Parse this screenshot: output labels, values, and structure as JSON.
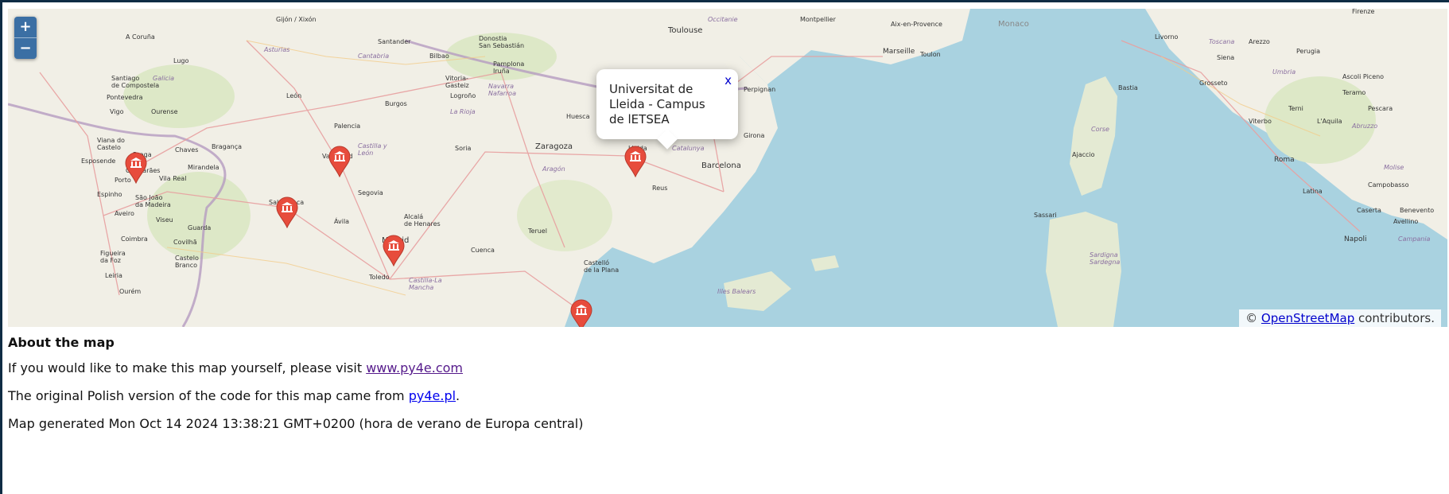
{
  "map": {
    "zoom_in_label": "+",
    "zoom_out_label": "−",
    "popup": {
      "title": "Universitat de Lleida - Campus de lETSEA",
      "close_label": "x"
    },
    "attribution": {
      "prefix": "© ",
      "link_text": "OpenStreetMap",
      "suffix": " contributors."
    },
    "marker_icon": "museum-icon",
    "marker_color": "#e74c3c",
    "places": {
      "gijon": "Gijón / Xixón",
      "santander": "Santander",
      "bilbao": "Bilbao",
      "donostia": "Donostia\nSan Sebastián",
      "toulouse": "Toulouse",
      "montpellier": "Montpellier",
      "aix": "Aix-en-Provence",
      "marseille": "Marseille",
      "toulon": "Toulon",
      "monaco": "Monaco",
      "firenze": "Firenze",
      "coruna": "A Coruña",
      "lugo": "Lugo",
      "asturias": "Asturias",
      "cantabria": "Cantabria",
      "pamplona": "Pamplona\nIruña",
      "vitoria": "Vitoria-\nGasteiz",
      "santiago": "Santiago\nde Compostela",
      "galicia": "Galicia",
      "leon": "León",
      "burgos": "Burgos",
      "logrono": "Logroño",
      "navarra": "Navarra\nNafarroa",
      "larioja": "La Rioja",
      "huesca": "Huesca",
      "perpignan": "Perpignan",
      "pontevedra": "Pontevedra",
      "vigo": "Vigo",
      "ourense": "Ourense",
      "palencia": "Palencia",
      "castilla": "Castilla y\nLeón",
      "girona": "Girona",
      "zaragoza": "Zaragoza",
      "lleida": "Lleida",
      "catalunya": "Catalunya",
      "barcelona": "Barcelona",
      "viana": "Viana do\nCastelo",
      "braga": "Braga",
      "chaves": "Chaves",
      "braganca": "Bragança",
      "valladolid": "Valladolid",
      "soria": "Soria",
      "esposende": "Esposende",
      "guimaraes": "Guimarães",
      "mirandela": "Mirandela",
      "vilareal": "Vila Real",
      "porto": "Porto",
      "aragon": "Aragón",
      "salamanca": "Salamanca",
      "segovia": "Segovia",
      "reus": "Reus",
      "espinho": "Espinho",
      "sjoao": "São João\nda Madeira",
      "avila": "Ávila",
      "alcala": "Alcalá\nde Henares",
      "madrid": "Madrid",
      "teruel": "Teruel",
      "aveiro": "Aveiro",
      "viseu": "Viseu",
      "guarda": "Guarda",
      "coimbra": "Coimbra",
      "covilha": "Covilhã",
      "cuenca": "Cuenca",
      "figueira": "Figueira\nda Foz",
      "castelobranco": "Castelo\nBranco",
      "leiria": "Leiria",
      "toledo": "Toledo",
      "castillalm": "Castilla-La\nMancha",
      "castello": "Castelló\nde la Plana",
      "ourem": "Ourém",
      "illes": "Illes Balears",
      "bastia": "Bastia",
      "corse": "Corse",
      "ajaccio": "Ajaccio",
      "sassari": "Sassari",
      "sardegna": "Sardigna\nSardegna",
      "livorno": "Livorno",
      "siena": "Siena",
      "toscana": "Toscana",
      "grosseto": "Grosseto",
      "arezzo": "Arezzo",
      "perugia": "Perugia",
      "umbria": "Umbria",
      "ascoli": "Ascoli Piceno",
      "teramo": "Teramo",
      "pescara": "Pescara",
      "laquila": "L'Aquila",
      "abruzzo": "Abruzzo",
      "viterbo": "Viterbo",
      "terni": "Terni",
      "roma": "Roma",
      "latina": "Latina",
      "campobasso": "Campobasso",
      "molise": "Molise",
      "caserta": "Caserta",
      "avellino": "Avellino",
      "benevento": "Benevento",
      "napoli": "Napoli",
      "campania": "Campania",
      "occitanie": "Occitanie"
    }
  },
  "about": {
    "heading": "About the map",
    "line1_text": "If you would like to make this map yourself, please visit ",
    "line1_link": "www.py4e.com",
    "line2_text": "The original Polish version of the code for this map came from ",
    "line2_link": "py4e.pl",
    "line2_end": ".",
    "line3": "Map generated Mon Oct 14 2024 13:38:21 GMT+0200 (hora de verano de Europa central)"
  }
}
